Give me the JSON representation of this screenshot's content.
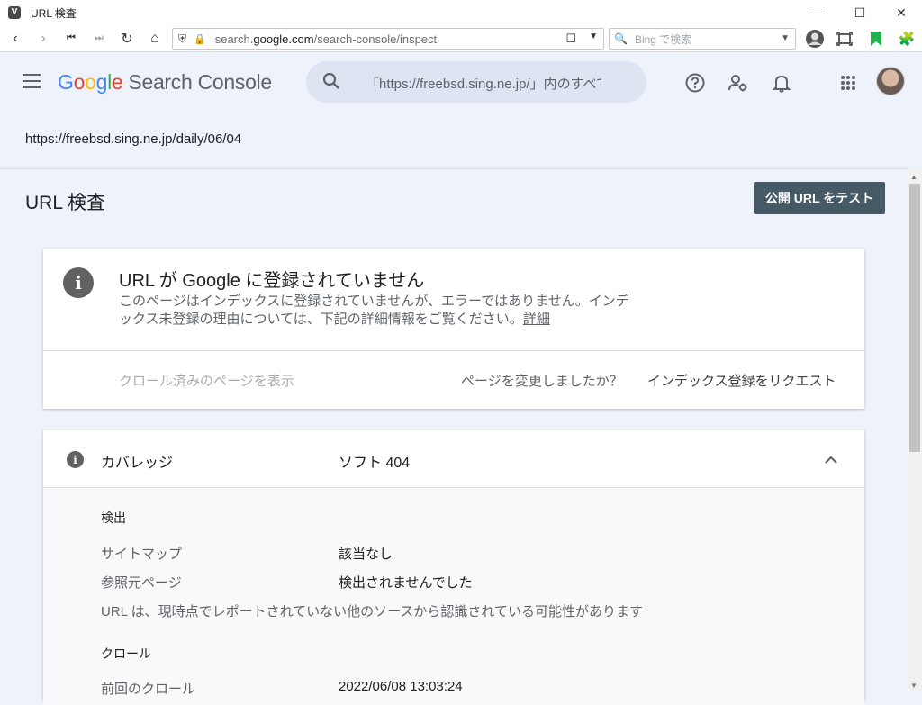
{
  "window": {
    "title": "URL 検査",
    "minimize": "—",
    "maximize": "☐",
    "close": "✕"
  },
  "browser": {
    "url_prefix": "search.",
    "url_domain": "google.com",
    "url_path": "/search-console/inspect",
    "search_placeholder": "Bing で検索"
  },
  "header": {
    "logo_letters": [
      "G",
      "o",
      "o",
      "g",
      "l",
      "e"
    ],
    "product_name": "Search Console",
    "search_text": "「https://freebsd.sing.ne.jp/」内のすべてのURLを検査"
  },
  "inspected_url": "https://freebsd.sing.ne.jp/daily/06/04",
  "page": {
    "title": "URL 検査",
    "test_button": "公開 URL をテスト"
  },
  "status_card": {
    "title": "URL が Google に登録されていません",
    "description": "このページはインデックスに登録されていませんが、エラーではありません。インデックス未登録の理由については、下記の詳細情報をご覧ください。",
    "details_link": "詳細",
    "view_crawled": "クロール済みのページを表示",
    "changed_question": "ページを変更しましたか？",
    "request_indexing": "インデックス登録をリクエスト"
  },
  "coverage": {
    "label": "カバレッジ",
    "value": "ソフト 404",
    "discovery_heading": "検出",
    "rows": [
      {
        "label": "サイトマップ",
        "value": "該当なし"
      },
      {
        "label": "参照元ページ",
        "value": "検出されませんでした"
      }
    ],
    "note": "URL は、現時点でレポートされていない他のソースから認識されている可能性があります",
    "crawl_heading": "クロール",
    "last_crawl_label": "前回のクロール",
    "last_crawl_value": "2022/06/08 13:03:24"
  }
}
